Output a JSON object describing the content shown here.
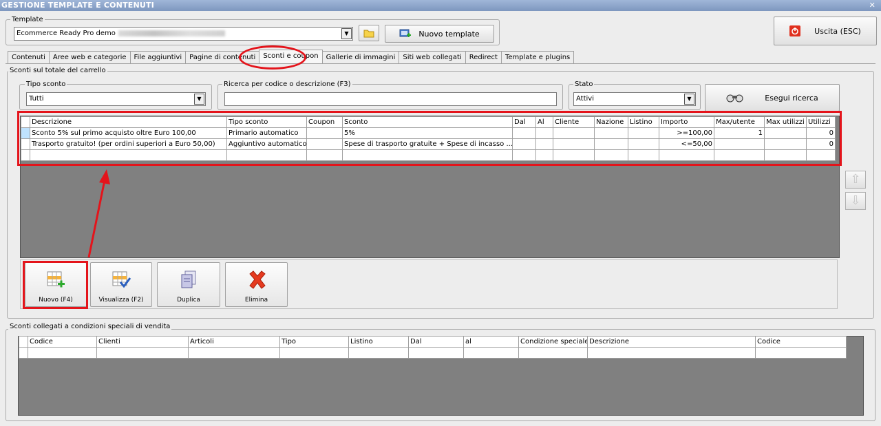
{
  "window": {
    "title": "GESTIONE TEMPLATE E CONTENUTI",
    "close": "✕"
  },
  "template": {
    "group_label": "Template",
    "selected": "Ecommerce Ready Pro demo",
    "new_button": "Nuovo template"
  },
  "exit_button": "Uscita (ESC)",
  "tabs": [
    {
      "label": "Contenuti"
    },
    {
      "label": "Aree web e categorie"
    },
    {
      "label": "File aggiuntivi"
    },
    {
      "label": "Pagine di contenuti"
    },
    {
      "label": "Sconti e coupon"
    },
    {
      "label": "Gallerie di immagini"
    },
    {
      "label": "Siti web collegati"
    },
    {
      "label": "Redirect"
    },
    {
      "label": "Template e plugins"
    }
  ],
  "cart": {
    "group_label": "Sconti sul totale del carrello",
    "tipo_label": "Tipo sconto",
    "tipo_value": "Tutti",
    "search_label": "Ricerca per codice o descrizione (F3)",
    "search_value": "",
    "stato_label": "Stato",
    "stato_value": "Attivi",
    "search_button": "Esegui ricerca",
    "columns": [
      "Descrizione",
      "Tipo sconto",
      "Coupon",
      "Sconto",
      "Dal",
      "Al",
      "Cliente",
      "Nazione",
      "Listino",
      "Importo",
      "Max/utente",
      "Max utilizzi",
      "Utilizzi"
    ],
    "rows": [
      {
        "descrizione": "Sconto 5% sul primo acquisto oltre Euro 100,00",
        "tipo": "Primario automatico",
        "coupon": "",
        "sconto": "5%",
        "dal": "",
        "al": "",
        "cliente": "",
        "nazione": "",
        "listino": "",
        "importo": ">=100,00",
        "max_utente": "1",
        "max_utilizzi": "",
        "utilizzi": "0"
      },
      {
        "descrizione": "Trasporto gratuito! (per ordini superiori a Euro 50,00)",
        "tipo": "Aggiuntivo automatico",
        "coupon": "",
        "sconto": "Spese di trasporto gratuite + Spese di incasso ...",
        "dal": "",
        "al": "",
        "cliente": "",
        "nazione": "",
        "listino": "",
        "importo": "<=50,00",
        "max_utente": "",
        "max_utilizzi": "",
        "utilizzi": "0"
      }
    ]
  },
  "actions": {
    "nuovo": "Nuovo (F4)",
    "visualizza": "Visualizza (F2)",
    "duplica": "Duplica",
    "elimina": "Elimina"
  },
  "special": {
    "group_label": "Sconti collegati a condizioni speciali di vendita",
    "columns": [
      "Codice",
      "Clienti",
      "Articoli",
      "Tipo",
      "Listino",
      "Dal",
      "al",
      "Condizione speciale",
      "Descrizione",
      "Codice"
    ]
  },
  "colors": {
    "highlight": "#e4141b",
    "grid_bg": "#808080",
    "selection": "#bfe3ff"
  }
}
